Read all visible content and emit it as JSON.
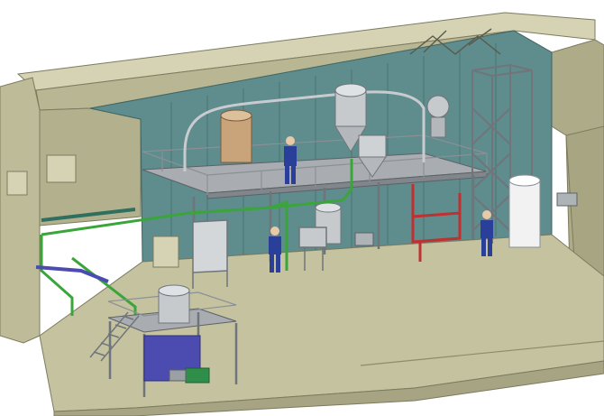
{
  "image": {
    "kind": "isometric CAD rendering of an industrial process plant interior",
    "colors": {
      "background": "#ffffff",
      "building": "#b9b793",
      "building_dark": "#8e8c6c",
      "floor": "#c4c29f",
      "wall_panel": "#5f8c8c",
      "steel": "#b8bdc2",
      "steel_dark": "#6f757a",
      "pipe_green": "#3aa53a",
      "pipe_blue": "#4b4bb0",
      "frame_red": "#c03030",
      "worker_blue": "#2a3f9a",
      "motor_green": "#2f8f4a"
    }
  }
}
